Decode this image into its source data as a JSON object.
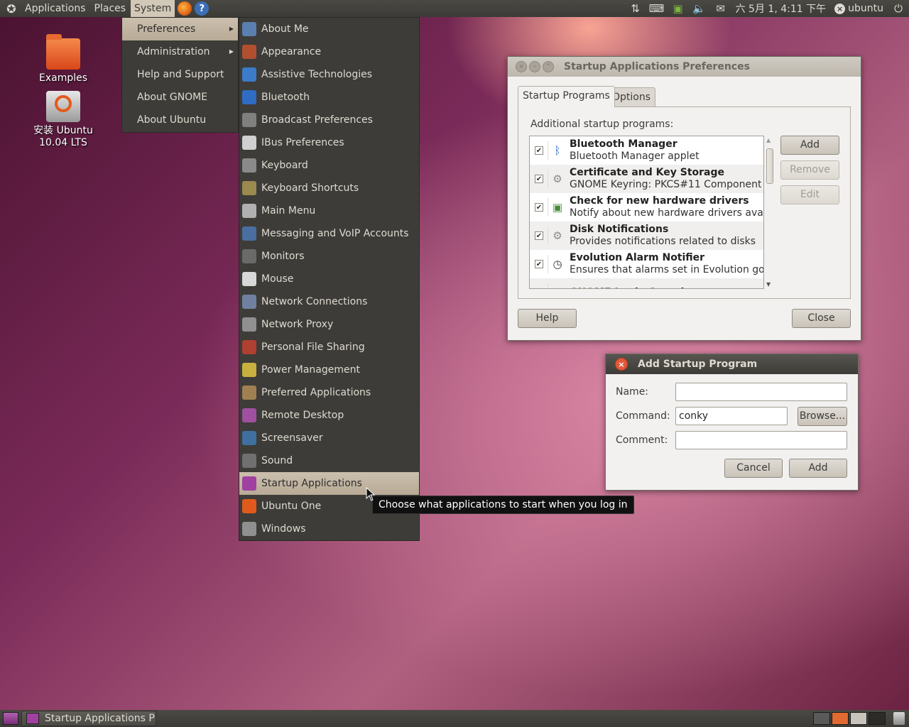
{
  "top_panel": {
    "menus": [
      "Applications",
      "Places",
      "System"
    ],
    "active_menu": "System",
    "tray": {
      "datetime": "六 5月 1, 4:11 下午",
      "user": "ubuntu"
    }
  },
  "desktop": {
    "icons": [
      {
        "label": "Examples"
      },
      {
        "label": "安装 Ubuntu 10.04 LTS"
      }
    ]
  },
  "system_menu": {
    "items": [
      "Preferences",
      "Administration",
      "Help and Support",
      "About GNOME",
      "About Ubuntu"
    ],
    "highlighted": "Preferences"
  },
  "preferences_menu": {
    "items": [
      {
        "label": "About Me",
        "icon": "about-me-icon",
        "color": "#5b7fb0"
      },
      {
        "label": "Appearance",
        "icon": "appearance-icon",
        "color": "#b05030"
      },
      {
        "label": "Assistive Technologies",
        "icon": "accessibility-icon",
        "color": "#3b7bc8"
      },
      {
        "label": "Bluetooth",
        "icon": "bluetooth-icon",
        "color": "#2f6cc4"
      },
      {
        "label": "Broadcast Preferences",
        "icon": "broadcast-icon",
        "color": "#808080"
      },
      {
        "label": "IBus Preferences",
        "icon": "ibus-icon",
        "color": "#d0d0d0"
      },
      {
        "label": "Keyboard",
        "icon": "keyboard-icon",
        "color": "#8a8a8a"
      },
      {
        "label": "Keyboard Shortcuts",
        "icon": "keyboard-shortcuts-icon",
        "color": "#9a8a50"
      },
      {
        "label": "Main Menu",
        "icon": "main-menu-icon",
        "color": "#b0b0b0"
      },
      {
        "label": "Messaging and VoIP Accounts",
        "icon": "messaging-icon",
        "color": "#4a6ea0"
      },
      {
        "label": "Monitors",
        "icon": "monitors-icon",
        "color": "#6a6a6a"
      },
      {
        "label": "Mouse",
        "icon": "mouse-icon",
        "color": "#d8d8d8"
      },
      {
        "label": "Network Connections",
        "icon": "network-connections-icon",
        "color": "#7080a0"
      },
      {
        "label": "Network Proxy",
        "icon": "network-proxy-icon",
        "color": "#909090"
      },
      {
        "label": "Personal File Sharing",
        "icon": "file-sharing-icon",
        "color": "#b04030"
      },
      {
        "label": "Power Management",
        "icon": "power-management-icon",
        "color": "#c8b040"
      },
      {
        "label": "Preferred Applications",
        "icon": "preferred-apps-icon",
        "color": "#a08050"
      },
      {
        "label": "Remote Desktop",
        "icon": "remote-desktop-icon",
        "color": "#a050a0"
      },
      {
        "label": "Screensaver",
        "icon": "screensaver-icon",
        "color": "#4070a0"
      },
      {
        "label": "Sound",
        "icon": "sound-icon",
        "color": "#707070"
      },
      {
        "label": "Startup Applications",
        "icon": "startup-applications-icon",
        "color": "#a040a0"
      },
      {
        "label": "Ubuntu One",
        "icon": "ubuntu-one-icon",
        "color": "#e05a1c"
      },
      {
        "label": "Windows",
        "icon": "windows-icon",
        "color": "#909090"
      }
    ],
    "highlighted": "Startup Applications",
    "tooltip": "Choose what applications to start when you log in"
  },
  "startup_prefs_window": {
    "title": "Startup Applications Preferences",
    "tabs": [
      "Startup Programs",
      "Options"
    ],
    "active_tab": "Startup Programs",
    "list_label": "Additional startup programs:",
    "programs": [
      {
        "checked": true,
        "name": "Bluetooth Manager",
        "desc": "Bluetooth Manager applet",
        "icon": "bluetooth-icon"
      },
      {
        "checked": true,
        "name": "Certificate and Key Storage",
        "desc": "GNOME Keyring: PKCS#11 Component",
        "icon": "gears-icon"
      },
      {
        "checked": true,
        "name": "Check for new hardware drivers",
        "desc": "Notify about new hardware drivers ava...",
        "icon": "hardware-card-icon"
      },
      {
        "checked": true,
        "name": "Disk Notifications",
        "desc": "Provides notifications related to disks",
        "icon": "gears-icon"
      },
      {
        "checked": true,
        "name": "Evolution Alarm Notifier",
        "desc": "Ensures that alarms set in Evolution go...",
        "icon": "clock-icon"
      },
      {
        "checked": true,
        "name": "GNOME Login Sound",
        "desc": "",
        "icon": "gears-icon"
      }
    ],
    "buttons": {
      "add": "Add",
      "remove": "Remove",
      "edit": "Edit",
      "help": "Help",
      "close": "Close"
    }
  },
  "add_program_dialog": {
    "title": "Add Startup Program",
    "fields": {
      "name_label": "Name:",
      "name_value": "",
      "command_label": "Command:",
      "command_value": "conky",
      "comment_label": "Comment:",
      "comment_value": ""
    },
    "buttons": {
      "browse": "Browse...",
      "cancel": "Cancel",
      "add": "Add"
    }
  },
  "bottom_panel": {
    "task": "Startup Applications Pr..."
  }
}
